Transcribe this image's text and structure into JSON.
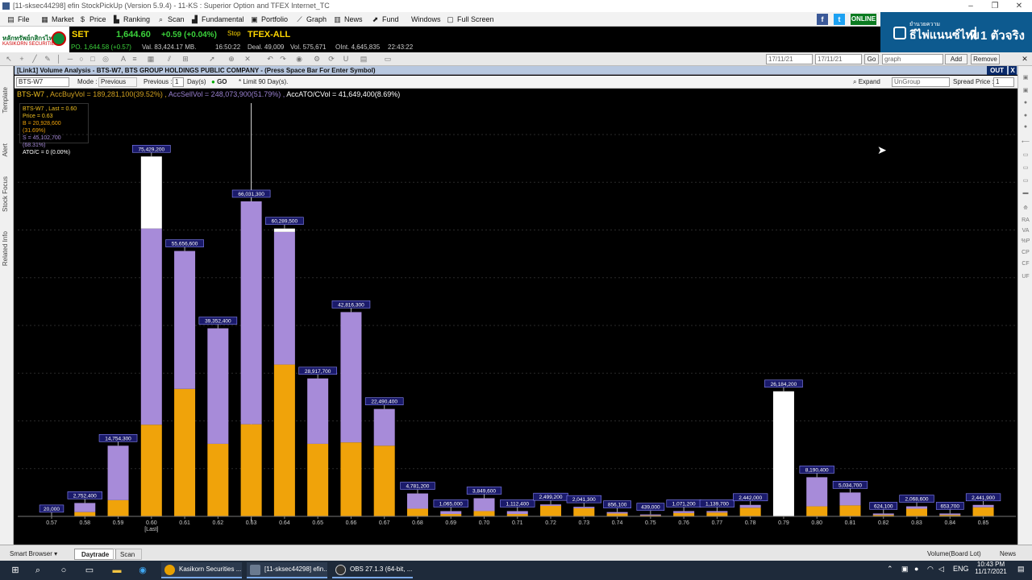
{
  "window": {
    "title": "[11-sksec44298] efin StockPickUp (Version 5.9.4) - 11-KS : Superior Option and TFEX Internet_TC",
    "min": "–",
    "max": "❐",
    "close": "✕"
  },
  "menu": [
    {
      "label": "File",
      "icon": "file-icon",
      "glyph": "▤"
    },
    {
      "label": "Market",
      "icon": "market-icon",
      "glyph": "▦"
    },
    {
      "label": "Price",
      "icon": "dollar-icon",
      "glyph": "$"
    },
    {
      "label": "Ranking",
      "icon": "ranking-icon",
      "glyph": "▙"
    },
    {
      "label": "Scan",
      "icon": "scan-icon",
      "glyph": "⌕"
    },
    {
      "label": "Fundamental",
      "icon": "fundamental-icon",
      "glyph": "▟"
    },
    {
      "label": "Portfolio",
      "icon": "portfolio-icon",
      "glyph": "▣"
    },
    {
      "label": "Graph",
      "icon": "graph-icon",
      "glyph": "⟋"
    },
    {
      "label": "News",
      "icon": "news-icon",
      "glyph": "▥"
    },
    {
      "label": "Fund",
      "icon": "fund-icon",
      "glyph": "⬈"
    },
    {
      "label": "Windows",
      "icon": "",
      "glyph": ""
    },
    {
      "label": "Full Screen",
      "icon": "fullscreen-icon",
      "glyph": "▢"
    }
  ],
  "social": {
    "facebook": "f",
    "twitter": "t",
    "online": "ONLINE"
  },
  "banner": {
    "small": "ยำนวยความ",
    "big": "ธีไพ่แนนซ์ไทย",
    "slogan": "ที่ 1 ตัวจริง"
  },
  "broker": {
    "name": "หลักทรัพย์กสิกรไทย",
    "sub": "KASIKORN SECURITIES"
  },
  "ticker": {
    "index": "SET",
    "value": "1,644.60",
    "change": "+0.59 (+0.04%)",
    "stop": "Stop",
    "po": "PO. 1,644.58 (+0.57)",
    "val": "Val. 83,424.17 MB.",
    "time": "16:50:22",
    "tfex": "TFEX-ALL",
    "deal": "Deal. 49,009",
    "vol": "Vol. 575,671",
    "oint": "OInt. 4,645,835",
    "tfex_time": "22:43:22"
  },
  "toolbar": {
    "date_from": "17/11/21",
    "date_to": "17/11/21",
    "go": "Go",
    "graph_field": "graph",
    "add": "Add",
    "remove": "Remove"
  },
  "lefttabs": [
    "Template",
    "Alert",
    "Stock Focus",
    "Related Info"
  ],
  "righttabs": [
    "RA",
    "VA",
    "%P",
    "CP",
    "CF",
    "UF"
  ],
  "panel": {
    "header": "[Link1] Volume Analysis - BTS-W7, BTS GROUP HOLDINGS PUBLIC COMPANY - (Press Space Bar For Enter Symbol)",
    "out": "OUT",
    "close": "X",
    "symbol": "BTS-W7",
    "mode_label": "Mode :",
    "mode_value": "Previous",
    "prev_label": "Previous :",
    "prev_value": "1",
    "days_label": "Day(s)",
    "go": "GO",
    "limit": "* Limit 90 Day(s).",
    "expand": "Expand",
    "group": "UnGroup",
    "spread_label": "Spread Price :",
    "spread_value": "1"
  },
  "summary": {
    "symbol": "BTS-W7 ,",
    "buy": "AccBuyVol = 189,281,100(39.52%) ,",
    "sell": "AccSellVol = 248,073,900(51.79%) ,",
    "ato": "AccATO/CVol = 41,649,400(8.69%)"
  },
  "infobox": {
    "last": "BTS-W7 , Last = 0.60",
    "price": "Price = 0.63",
    "b": "B = 20,928,600 (31.69%)",
    "s": "S = 45,102,700 (68.31%)",
    "ato": "ATO/C = 0 (0.00%)"
  },
  "chart_data": {
    "type": "bar",
    "stacked": true,
    "categories": [
      "0.57",
      "0.58",
      "0.59",
      "0.60",
      "0.61",
      "0.62",
      "0.63",
      "0.64",
      "0.65",
      "0.66",
      "0.67",
      "0.68",
      "0.69",
      "0.70",
      "0.71",
      "0.72",
      "0.73",
      "0.74",
      "0.75",
      "0.76",
      "0.77",
      "0.78",
      "0.79",
      "0.80",
      "0.81",
      "0.82",
      "0.83",
      "0.84",
      "0.85"
    ],
    "last_marker": {
      "category": "0.60",
      "label": "[Last]"
    },
    "cursor_category": "0.63",
    "totals": [
      "20,000",
      "2,752,400",
      "14,754,300",
      "75,429,200",
      "55,656,600",
      "39,352,400",
      "66,031,300",
      "60,289,500",
      "28,917,700",
      "42,816,300",
      "22,490,400",
      "4,781,200",
      "1,065,000",
      "3,849,600",
      "1,112,400",
      "2,499,200",
      "2,041,300",
      "856,100",
      "439,000",
      "1,071,200",
      "1,139,700",
      "2,442,000",
      "26,184,200",
      "8,190,400",
      "5,034,700",
      "624,100",
      "2,068,600",
      "653,700",
      "2,441,900"
    ],
    "series": [
      {
        "name": "Buy",
        "color": "#f0a30a",
        "values": [
          0.01,
          0.9,
          3.4,
          19.2,
          26.7,
          15.2,
          19.3,
          31.8,
          15.2,
          15.5,
          14.8,
          1.6,
          0.5,
          1.1,
          0.5,
          2.2,
          1.7,
          0.6,
          0.2,
          0.7,
          0.8,
          1.8,
          0,
          2.1,
          2.3,
          0.3,
          1.6,
          0.3,
          1.9
        ]
      },
      {
        "name": "Sell",
        "color": "#a78bd9",
        "values": [
          0.01,
          1.9,
          11.4,
          41.1,
          28.9,
          24.2,
          46.7,
          27.8,
          13.7,
          27.3,
          7.7,
          3.2,
          0.6,
          2.7,
          0.6,
          0.3,
          0.3,
          0.3,
          0.2,
          0.4,
          0.3,
          0.6,
          0,
          6.1,
          2.7,
          0.3,
          0.5,
          0.3,
          0.5
        ]
      },
      {
        "name": "ATO/C",
        "color": "#ffffff",
        "values": [
          0,
          0,
          0,
          15.1,
          0,
          0,
          0,
          0.7,
          0,
          0,
          0,
          0,
          0,
          0,
          0,
          0,
          0,
          0,
          0,
          0,
          0,
          0,
          26.2,
          0,
          0,
          0,
          0,
          0,
          0
        ]
      }
    ],
    "ylim": [
      0,
      80
    ],
    "grid": true
  },
  "bottom": {
    "smart_browser": "Smart Browser",
    "tab_daytrade": "Daytrade",
    "tab_scan": "Scan",
    "volume_mode": "Volume(Board Lot)",
    "news_bar": "News Bar"
  },
  "taskbar": {
    "tasks": [
      "Kasikorn Securities ...",
      "[11-sksec44298] efin...",
      "OBS 27.1.3 (64-bit, ..."
    ],
    "lang": "ENG",
    "time": "10:43 PM",
    "date": "11/17/2021"
  }
}
